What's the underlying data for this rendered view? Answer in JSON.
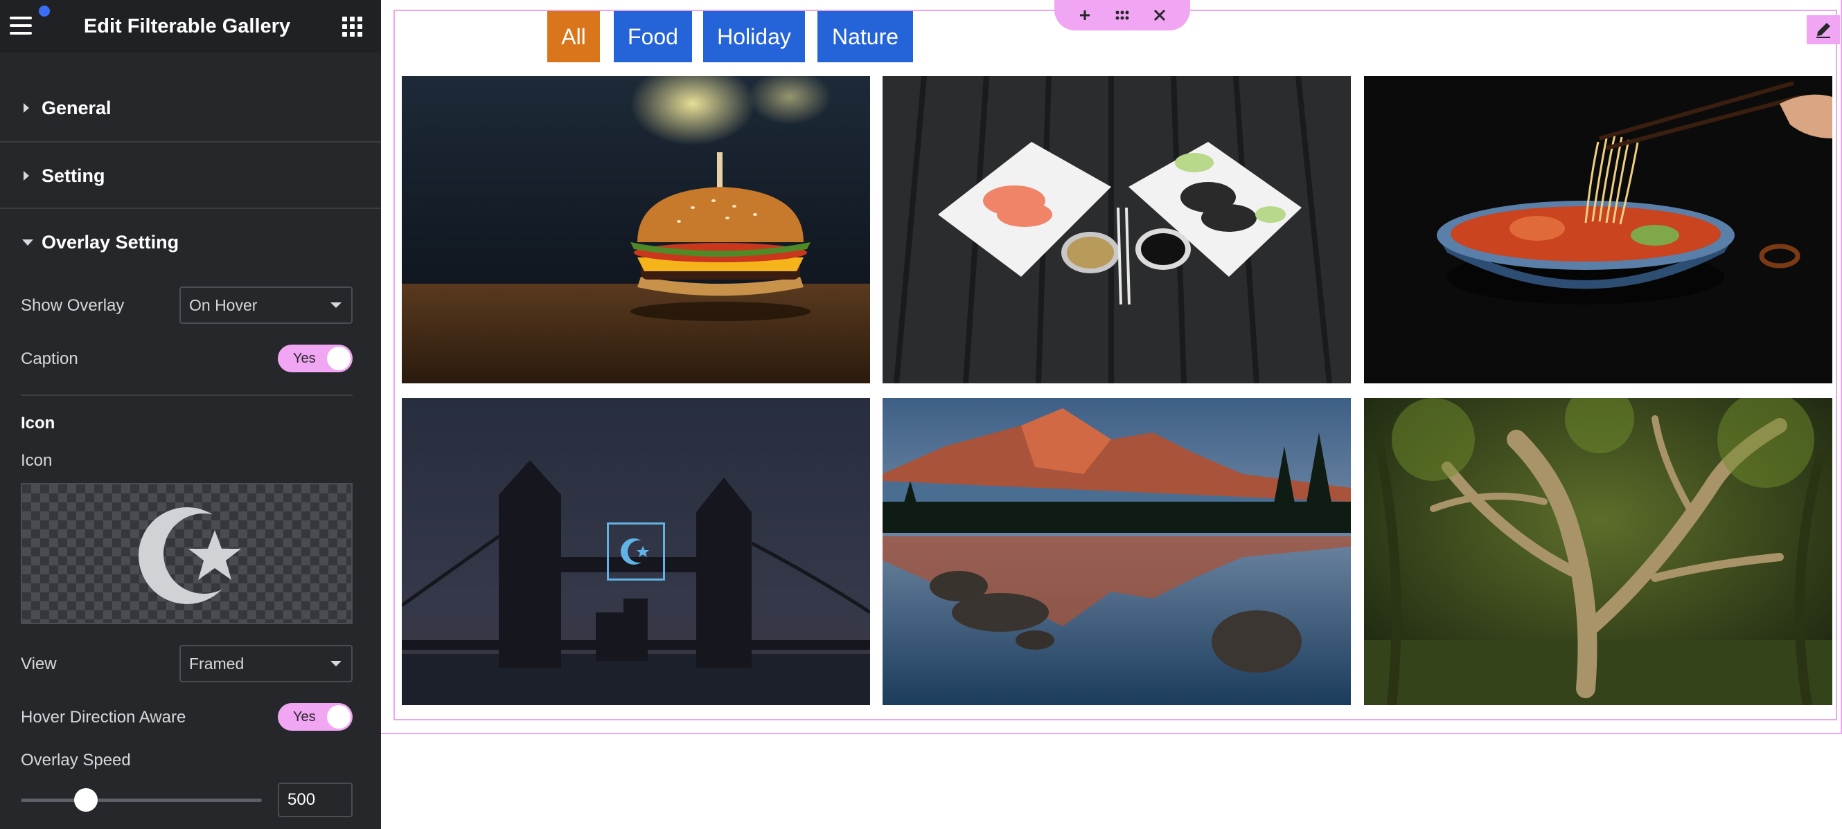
{
  "panel": {
    "title": "Edit Filterable Gallery",
    "sections": {
      "general": "General",
      "setting": "Setting",
      "overlay": "Overlay Setting"
    }
  },
  "controls": {
    "show_overlay": {
      "label": "Show Overlay",
      "value": "On Hover"
    },
    "caption": {
      "label": "Caption",
      "value": "Yes"
    },
    "icon_heading": "Icon",
    "icon_label": "Icon",
    "icon_name": "star-and-crescent-icon",
    "view": {
      "label": "View",
      "value": "Framed"
    },
    "hover_direction": {
      "label": "Hover Direction Aware",
      "value": "Yes"
    },
    "overlay_speed": {
      "label": "Overlay Speed",
      "value": "500",
      "slider_fraction": 0.27
    }
  },
  "gallery": {
    "filters": [
      {
        "label": "All",
        "active": true
      },
      {
        "label": "Food",
        "active": false
      },
      {
        "label": "Holiday",
        "active": false
      },
      {
        "label": "Nature",
        "active": false
      }
    ],
    "items": [
      {
        "name": "burger",
        "category": "Food"
      },
      {
        "name": "sushi",
        "category": "Food"
      },
      {
        "name": "noodles",
        "category": "Food"
      },
      {
        "name": "tower-bridge",
        "category": "Holiday"
      },
      {
        "name": "mountain-lake",
        "category": "Nature"
      },
      {
        "name": "forest-tree",
        "category": "Nature"
      }
    ]
  },
  "colors": {
    "sidebar_bg": "#26272b",
    "accent_pink": "#f0a6f2",
    "filter_active": "#d9751a",
    "filter_inactive": "#2463d8",
    "overlay_icon": "#61b3e6"
  }
}
